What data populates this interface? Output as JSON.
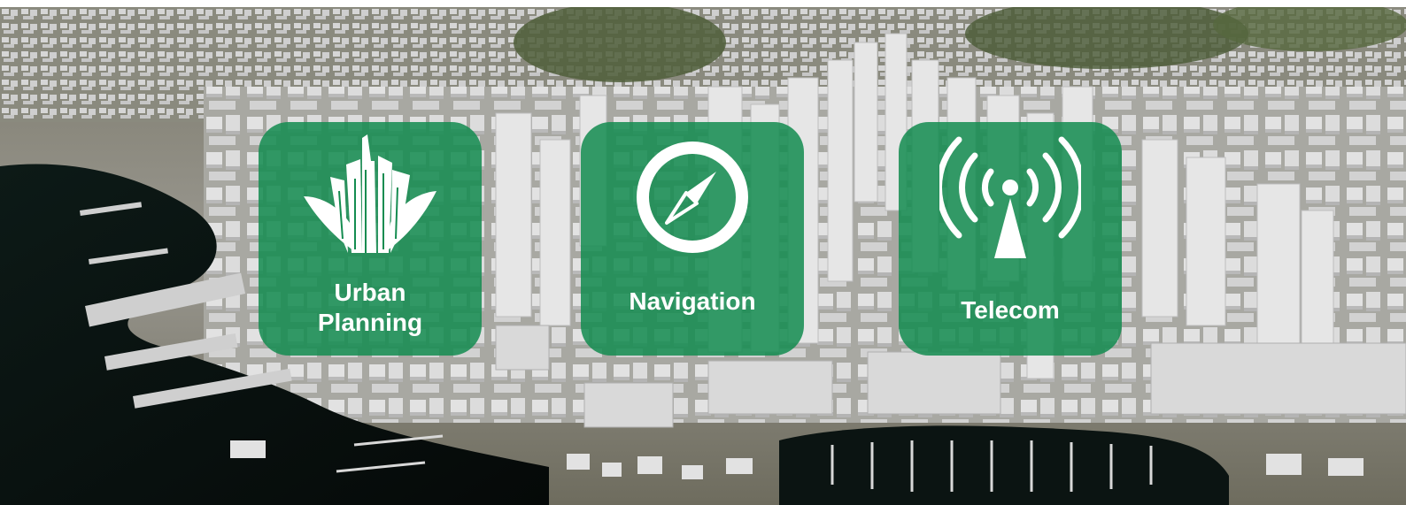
{
  "tiles": {
    "urban": {
      "label": "Urban\nPlanning",
      "icon": "city-buildings-icon"
    },
    "navigation": {
      "label": "Navigation",
      "icon": "compass-icon"
    },
    "telecom": {
      "label": "Telecom",
      "icon": "antenna-signal-icon"
    }
  },
  "colors": {
    "tile_green": "#148c50",
    "water": "#0a1412",
    "building": "#d8d8d8"
  }
}
